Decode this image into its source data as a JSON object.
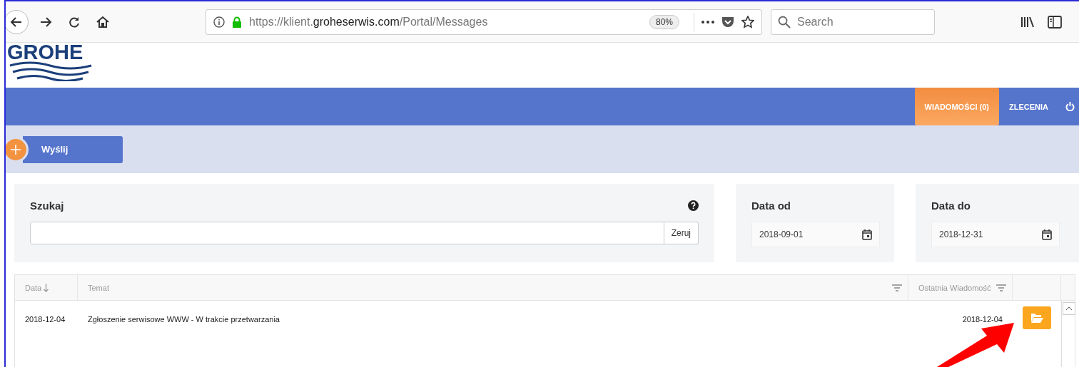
{
  "browser": {
    "url": {
      "host_prefix": "https://klient.",
      "domain": "groheserwis.com",
      "path": "/Portal/Messages"
    },
    "zoom": "80%",
    "search": {
      "placeholder": "Search"
    }
  },
  "logo": {
    "text": "GROHE"
  },
  "nav": {
    "items": [
      {
        "label": "WIADOMOŚCI (0)",
        "selected": true
      },
      {
        "label": "ZLECENIA",
        "selected": false
      }
    ]
  },
  "actions": {
    "send_button": "Wyślij"
  },
  "filters": {
    "search": {
      "label": "Szukaj",
      "reset_button": "Zeruj"
    },
    "date_from": {
      "label": "Data od",
      "value": "2018-09-01"
    },
    "date_to": {
      "label": "Data do",
      "value": "2018-12-31"
    }
  },
  "table": {
    "columns": [
      {
        "label": "Data",
        "kind": "sort"
      },
      {
        "label": "Temat",
        "kind": "filter"
      },
      {
        "label": "Ostatnia Wiadomość",
        "kind": "filter"
      }
    ],
    "rows": [
      {
        "date": "2018-12-04",
        "subject": "Zgłoszenie serwisowe WWW - W trakcie przetwarzania",
        "last_message": "2018-12-04"
      }
    ]
  }
}
